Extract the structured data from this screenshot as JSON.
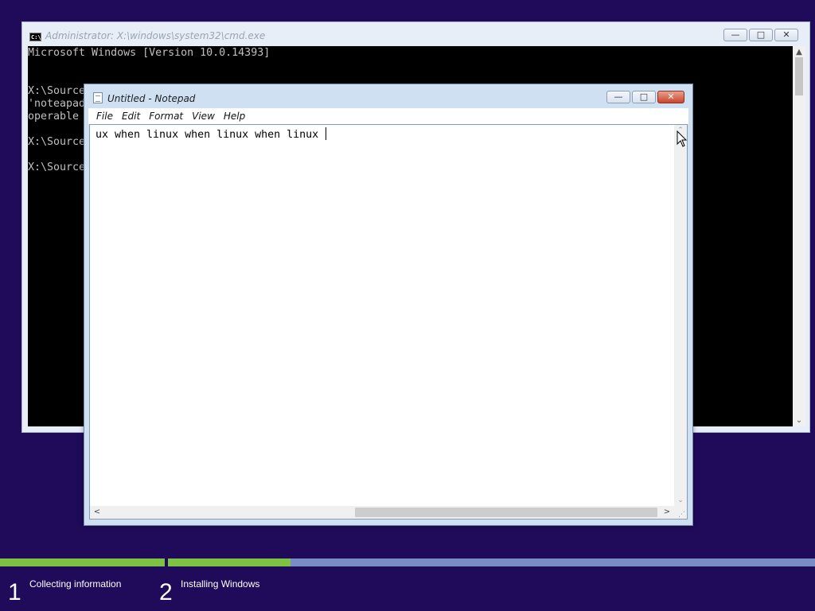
{
  "cmd": {
    "title": "Administrator: X:\\windows\\system32\\cmd.exe",
    "icon": "cmd-icon",
    "lines": [
      "Microsoft Windows [Version 10.0.14393]",
      "",
      "",
      "X:\\Source",
      "'noteapad",
      "operable",
      "",
      "X:\\Source",
      "",
      "X:\\Source"
    ],
    "scroll_up": "▲",
    "scroll_down": "⌄"
  },
  "notepad": {
    "title": "Untitled - Notepad",
    "menu": [
      "File",
      "Edit",
      "Format",
      "View",
      "Help"
    ],
    "content": "ux when linux when linux when linux ",
    "scroll_up": "⌃",
    "scroll_down": "⌄",
    "scroll_left": "<",
    "scroll_right": ">"
  },
  "caption": {
    "minimize": "—",
    "maximize": "□",
    "close": "✕"
  },
  "setup": {
    "steps": [
      {
        "number": "1",
        "label": "Collecting information",
        "progress": 1.0
      },
      {
        "number": "2",
        "label": "Installing Windows",
        "progress": 0.19
      }
    ],
    "colors": {
      "background": "#1f0b5a",
      "progress_fill": "#7dc242",
      "progress_track": "#7a8cc6"
    }
  }
}
